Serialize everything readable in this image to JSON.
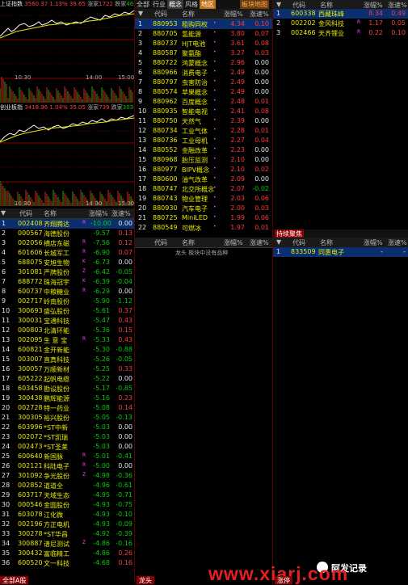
{
  "chart1": {
    "index_name": "上证指数",
    "value": "3560.37",
    "pct": "1.13%",
    "chg": "39.65",
    "up_label": "涨家",
    "up_count": "1722",
    "down_label": "跌家",
    "down_count": "465",
    "times": [
      "10:30",
      "14:00",
      "15:00"
    ]
  },
  "chart2": {
    "index_name": "创业板指",
    "value": "3418.96",
    "pct": "1.04%",
    "chg": "35.05",
    "up_label": "涨家",
    "up_count": "739",
    "down_label": "跌家",
    "down_count": "303",
    "times": [
      "10:30",
      "14:00",
      "15:00"
    ]
  },
  "left_list": {
    "headers": [
      "代码",
      "名称",
      "涨幅%",
      "涨速%"
    ],
    "rows": [
      {
        "n": "1",
        "code": "002408",
        "name": "齐翔腾达",
        "flag": "R",
        "pct": "-10.00",
        "spd": "0.00"
      },
      {
        "n": "2",
        "code": "000567",
        "name": "海德股份",
        "flag": "",
        "pct": "-9.57",
        "spd": "0.13"
      },
      {
        "n": "3",
        "code": "002056",
        "name": "横店东磁",
        "flag": "R",
        "pct": "-7.56",
        "spd": "0.12"
      },
      {
        "n": "4",
        "code": "601606",
        "name": "长城军工",
        "flag": "R",
        "pct": "-6.90",
        "spd": "0.07"
      },
      {
        "n": "5",
        "code": "688075",
        "name": "安旭生物",
        "flag": "K",
        "pct": "-6.73",
        "spd": "0.00"
      },
      {
        "n": "6",
        "code": "301081",
        "name": "严牌股份",
        "flag": "Z",
        "pct": "-6.42",
        "spd": "-0.05"
      },
      {
        "n": "7",
        "code": "688772",
        "name": "珠海冠宇",
        "flag": "K",
        "pct": "-6.39",
        "spd": "-0.04"
      },
      {
        "n": "8",
        "code": "600737",
        "name": "中粮糖业",
        "flag": "R",
        "pct": "-6.29",
        "spd": "0.00"
      },
      {
        "n": "9",
        "code": "002717",
        "name": "岭南股份",
        "flag": "",
        "pct": "-5.90",
        "spd": "-1.12"
      },
      {
        "n": "10",
        "code": "300693",
        "name": "盛弘股份",
        "flag": "",
        "pct": "-5.61",
        "spd": "0.37"
      },
      {
        "n": "11",
        "code": "300031",
        "name": "宝通科技",
        "flag": "",
        "pct": "-5.47",
        "spd": "0.43"
      },
      {
        "n": "12",
        "code": "000803",
        "name": "北清环能",
        "flag": "",
        "pct": "-5.36",
        "spd": "0.15"
      },
      {
        "n": "13",
        "code": "002095",
        "name": "生 意 宝",
        "flag": "R",
        "pct": "-5.33",
        "spd": "0.43"
      },
      {
        "n": "14",
        "code": "600821",
        "name": "金开新能",
        "flag": "",
        "pct": "-5.30",
        "spd": "-0.88"
      },
      {
        "n": "15",
        "code": "003007",
        "name": "直真科技",
        "flag": "",
        "pct": "-5.26",
        "spd": "-0.05"
      },
      {
        "n": "16",
        "code": "300057",
        "name": "万顺新材",
        "flag": "",
        "pct": "-5.25",
        "spd": "0.33"
      },
      {
        "n": "17",
        "code": "605222",
        "name": "起帆电缆",
        "flag": "",
        "pct": "-5.22",
        "spd": "0.00"
      },
      {
        "n": "18",
        "code": "603458",
        "name": "勘设股份",
        "flag": "",
        "pct": "-5.17",
        "spd": "-0.85"
      },
      {
        "n": "19",
        "code": "300438",
        "name": "鹏辉能源",
        "flag": "",
        "pct": "-5.16",
        "spd": "0.23"
      },
      {
        "n": "20",
        "code": "002728",
        "name": "特一药业",
        "flag": "",
        "pct": "-5.08",
        "spd": "0.14"
      },
      {
        "n": "21",
        "code": "300305",
        "name": "裕兴股份",
        "flag": "",
        "pct": "-5.05",
        "spd": "-0.13"
      },
      {
        "n": "22",
        "code": "603996",
        "name": "*ST中新",
        "flag": "",
        "pct": "-5.03",
        "spd": "0.00"
      },
      {
        "n": "23",
        "code": "002072",
        "name": "*ST凯瑞",
        "flag": "",
        "pct": "-5.03",
        "spd": "0.00"
      },
      {
        "n": "24",
        "code": "002473",
        "name": "*ST圣莱",
        "flag": "",
        "pct": "-5.03",
        "spd": "0.00"
      },
      {
        "n": "25",
        "code": "600640",
        "name": "新国脉",
        "flag": "R",
        "pct": "-5.01",
        "spd": "-0.41"
      },
      {
        "n": "26",
        "code": "002121",
        "name": "科陆电子",
        "flag": "R",
        "pct": "-5.00",
        "spd": "0.00"
      },
      {
        "n": "27",
        "code": "301092",
        "name": "争光股份",
        "flag": "Z",
        "pct": "-4.98",
        "spd": "-0.36"
      },
      {
        "n": "28",
        "code": "002852",
        "name": "道道全",
        "flag": "",
        "pct": "-4.96",
        "spd": "-0.61"
      },
      {
        "n": "29",
        "code": "603717",
        "name": "天域生态",
        "flag": "",
        "pct": "-4.95",
        "spd": "-0.71"
      },
      {
        "n": "30",
        "code": "000546",
        "name": "金圆股份",
        "flag": "",
        "pct": "-4.93",
        "spd": "-0.75"
      },
      {
        "n": "31",
        "code": "603078",
        "name": "江化微",
        "flag": "",
        "pct": "-4.93",
        "spd": "-0.10"
      },
      {
        "n": "32",
        "code": "002196",
        "name": "方正电机",
        "flag": "",
        "pct": "-4.93",
        "spd": "-0.09"
      },
      {
        "n": "33",
        "code": "300278",
        "name": "*ST华昌",
        "flag": "",
        "pct": "-4.92",
        "spd": "-0.39"
      },
      {
        "n": "34",
        "code": "300887",
        "name": "谱尼测试",
        "flag": "Z",
        "pct": "-4.86",
        "spd": "-0.16"
      },
      {
        "n": "35",
        "code": "300432",
        "name": "富临精工",
        "flag": "",
        "pct": "-4.86",
        "spd": "0.26"
      },
      {
        "n": "36",
        "code": "600520",
        "name": "文一科技",
        "flag": "",
        "pct": "-4.68",
        "spd": "0.16"
      }
    ]
  },
  "sector_tabs": [
    "全部",
    "行业",
    "概念",
    "风格",
    "地区",
    "板块地图"
  ],
  "sector_list": {
    "headers": [
      "代码",
      "名称",
      "涨幅%",
      "涨速%"
    ],
    "rows": [
      {
        "n": "1",
        "code": "880953",
        "name": "租购同权",
        "pct": "4.34",
        "spd": "0.10"
      },
      {
        "n": "2",
        "code": "880705",
        "name": "氢能源",
        "pct": "3.80",
        "spd": "0.07"
      },
      {
        "n": "3",
        "code": "880737",
        "name": "HJT电池",
        "pct": "3.61",
        "spd": "0.08"
      },
      {
        "n": "4",
        "code": "880587",
        "name": "聚氨酯",
        "pct": "3.27",
        "spd": "0.03"
      },
      {
        "n": "5",
        "code": "880722",
        "name": "鸿蒙概念",
        "pct": "2.96",
        "spd": "0.00"
      },
      {
        "n": "6",
        "code": "880966",
        "name": "消费电子",
        "pct": "2.49",
        "spd": "0.00"
      },
      {
        "n": "7",
        "code": "880797",
        "name": "虫害防治",
        "pct": "2.49",
        "spd": "0.00"
      },
      {
        "n": "8",
        "code": "880574",
        "name": "苹果概念",
        "pct": "2.49",
        "spd": "0.00"
      },
      {
        "n": "9",
        "code": "880962",
        "name": "百度概念",
        "pct": "2.48",
        "spd": "0.01"
      },
      {
        "n": "10",
        "code": "880935",
        "name": "智能电视",
        "pct": "2.41",
        "spd": "0.08"
      },
      {
        "n": "11",
        "code": "880750",
        "name": "天然气",
        "pct": "2.39",
        "spd": "0.00"
      },
      {
        "n": "12",
        "code": "880734",
        "name": "工业气体",
        "pct": "2.28",
        "spd": "0.01"
      },
      {
        "n": "13",
        "code": "880736",
        "name": "工业母机",
        "pct": "2.27",
        "spd": "0.04"
      },
      {
        "n": "14",
        "code": "880552",
        "name": "金融改革",
        "pct": "2.23",
        "spd": "0.00"
      },
      {
        "n": "15",
        "code": "880968",
        "name": "胎压监测",
        "pct": "2.10",
        "spd": "0.00"
      },
      {
        "n": "16",
        "code": "880977",
        "name": "BIPV概念",
        "pct": "2.10",
        "spd": "0.02"
      },
      {
        "n": "17",
        "code": "880600",
        "name": "油气改革",
        "pct": "2.09",
        "spd": "0.00"
      },
      {
        "n": "18",
        "code": "880747",
        "name": "北交所概念",
        "pct": "2.07",
        "spd": "-0.02"
      },
      {
        "n": "19",
        "code": "880743",
        "name": "物业管理",
        "pct": "2.03",
        "spd": "0.06"
      },
      {
        "n": "20",
        "code": "880930",
        "name": "汽车电子",
        "pct": "2.00",
        "spd": "0.03"
      },
      {
        "n": "21",
        "code": "880725",
        "name": "MiniLED",
        "pct": "1.99",
        "spd": "0.06"
      },
      {
        "n": "22",
        "code": "880549",
        "name": "可燃冰",
        "pct": "1.97",
        "spd": "0.01"
      }
    ]
  },
  "top_right": {
    "headers": [
      "代码",
      "名称",
      "涨幅%",
      "涨速%"
    ],
    "rows": [
      {
        "n": "1",
        "code": "600338",
        "name": "西藏珠峰",
        "flag": "",
        "pct": "8.34",
        "spd": "0.49"
      },
      {
        "n": "2",
        "code": "002202",
        "name": "金风科技",
        "flag": "R",
        "pct": "1.17",
        "spd": "0.05"
      },
      {
        "n": "3",
        "code": "002466",
        "name": "天齐锂业",
        "flag": "R",
        "pct": "0.22",
        "spd": "0.10"
      }
    ]
  },
  "mid_left": {
    "headers": [
      "代码",
      "名称",
      "涨幅%",
      "涨速%"
    ],
    "title": "龙头",
    "empty_text": "龙头 板块中没有品种"
  },
  "mid_right": {
    "tab": "持续聚焦",
    "headers": [
      "代码",
      "名称",
      "涨幅%",
      "涨速%"
    ],
    "rows": [
      {
        "n": "1",
        "code": "833509",
        "name": "同惠电子",
        "pct": "-",
        "spd": "-"
      }
    ]
  },
  "watermark": "www.xiarj.com",
  "watermark_badge": "阿发记录",
  "bottom_tabs": [
    "全部A股",
    "龙头",
    "涨停"
  ]
}
